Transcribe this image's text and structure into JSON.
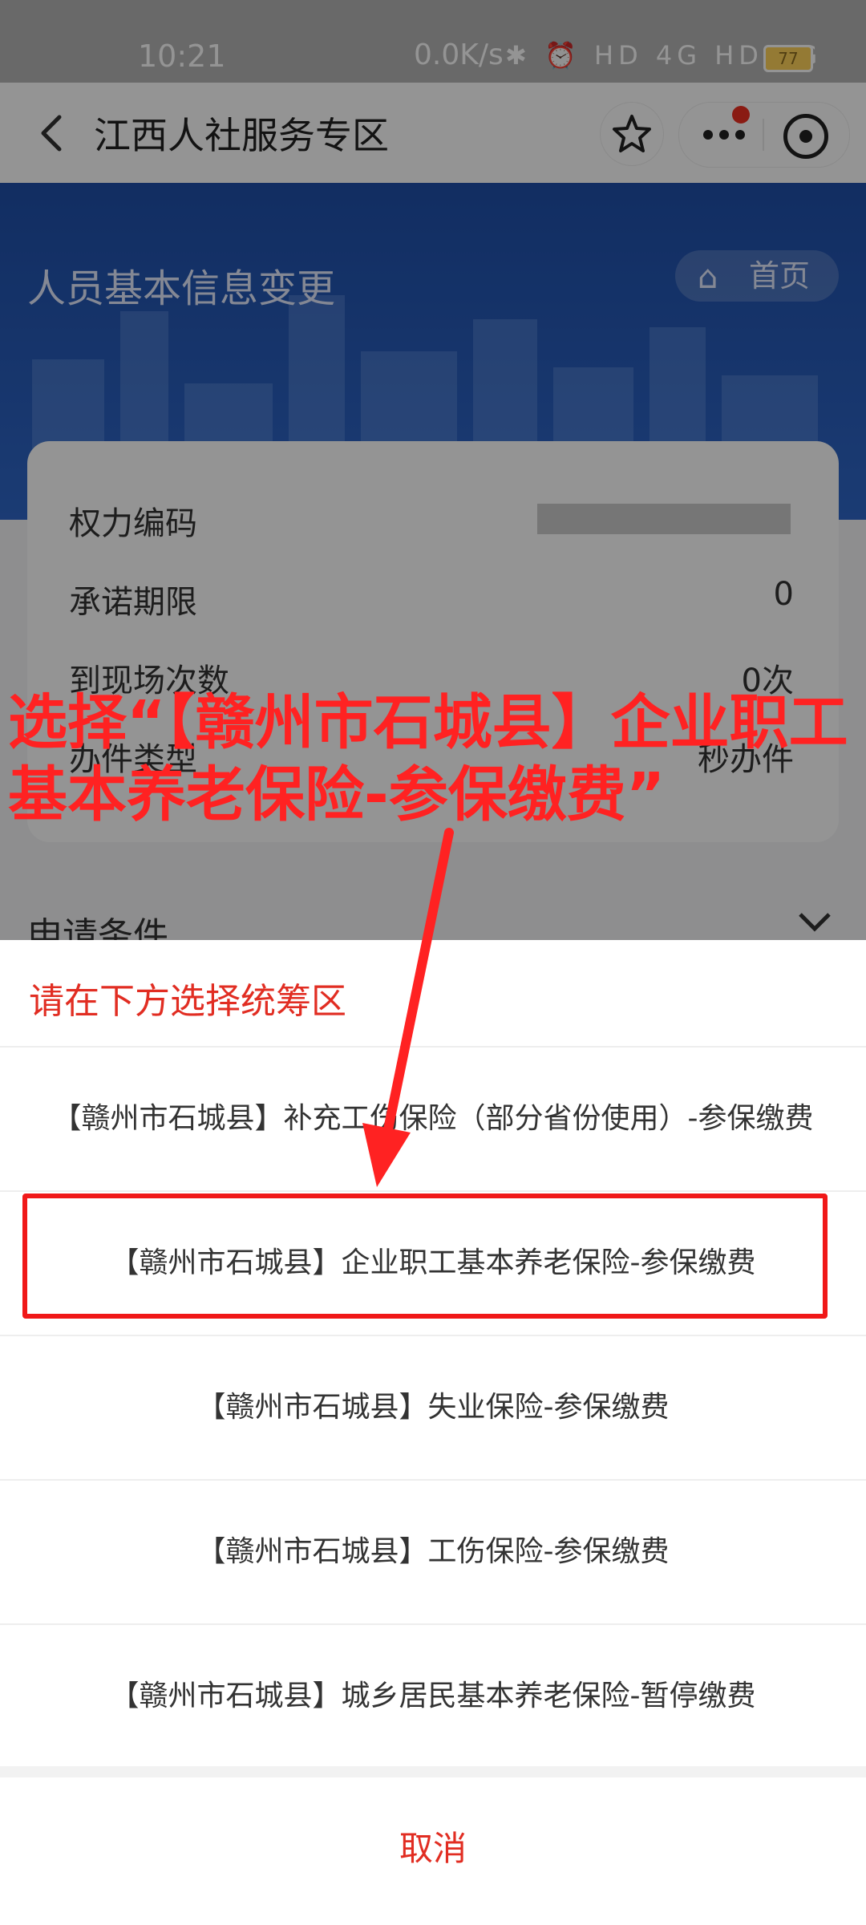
{
  "status_bar": {
    "time": "10:21",
    "speed": "0.0K/s",
    "icons": "✱ ⏰ HD 4G HD 4G",
    "battery": "77"
  },
  "nav": {
    "title": "江西人社服务专区",
    "back_icon": "chevron-left-icon",
    "star_icon": "star-icon",
    "more_icon": "more-dots-icon",
    "target_icon": "target-icon"
  },
  "page": {
    "title": "人员基本信息变更",
    "home_label": "首页"
  },
  "info": {
    "rows": [
      {
        "label": "权力编码",
        "value": ""
      },
      {
        "label": "承诺期限",
        "value": "0"
      },
      {
        "label": "到现场次数",
        "value": "0次"
      },
      {
        "label": "办件类型",
        "value": "秒办件"
      }
    ],
    "conditions_label": "申请条件"
  },
  "annotation": {
    "text": "选择“【赣州市石城县】企业职工基本养老保险-参保缴费”",
    "color": "#ff2222"
  },
  "sheet": {
    "title": "请在下方选择统筹区",
    "options": [
      "【赣州市石城县】补充工伤保险（部分省份使用）-参保缴费",
      "【赣州市石城县】企业职工基本养老保险-参保缴费",
      "【赣州市石城县】失业保险-参保缴费",
      "【赣州市石城县】工伤保险-参保缴费",
      "【赣州市石城县】城乡居民基本养老保险-暂停缴费"
    ],
    "cancel_label": "取消"
  },
  "colors": {
    "accent_red": "#e12d22",
    "header_blue": "#2f67c8"
  }
}
